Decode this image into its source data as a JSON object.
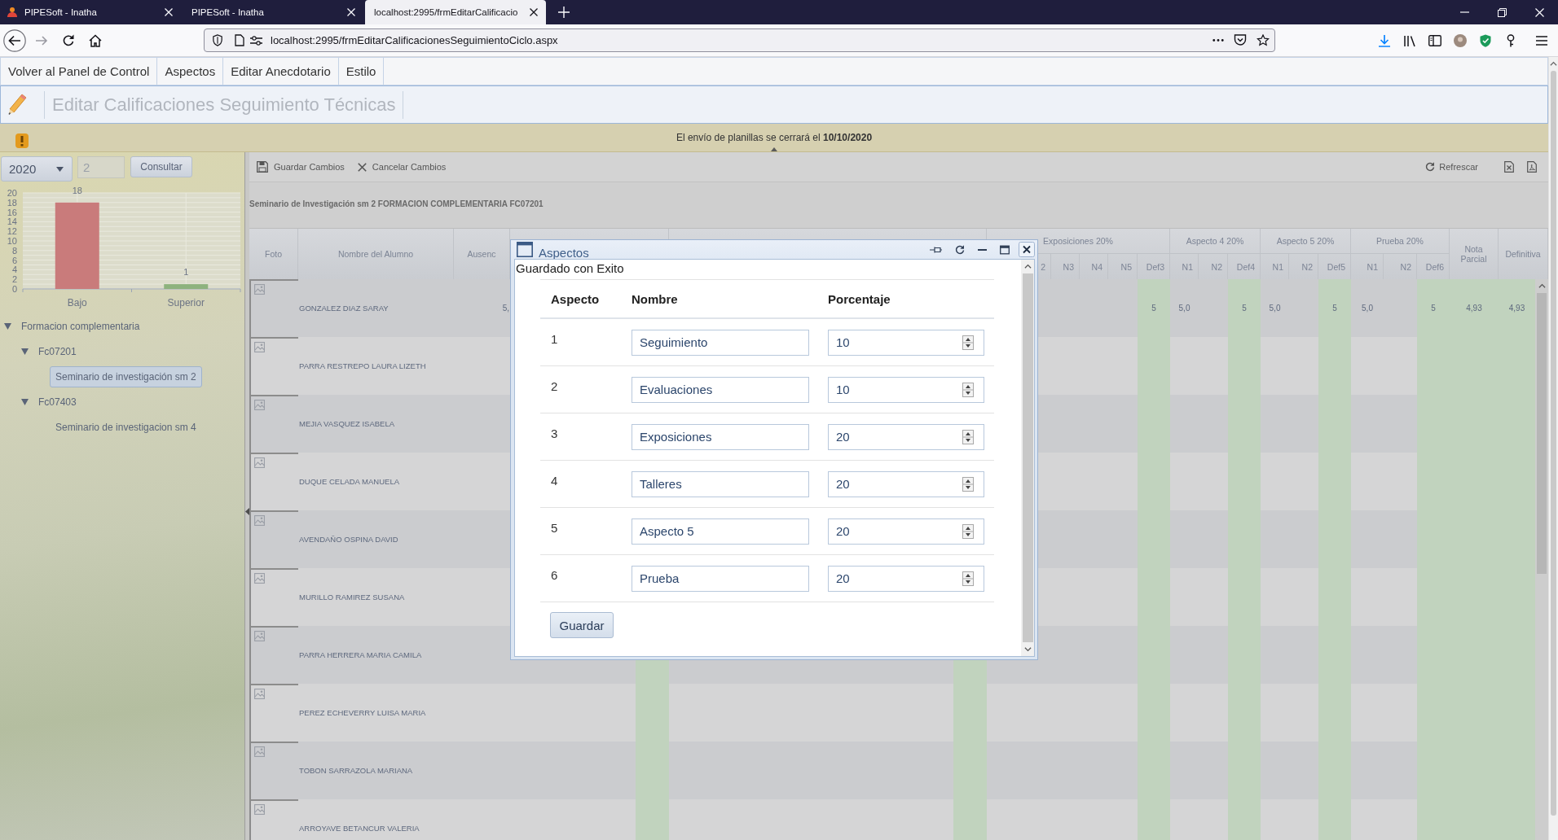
{
  "browser": {
    "tabs": [
      {
        "title": "PIPESoft - Inatha",
        "selected": false,
        "favicon": true
      },
      {
        "title": "PIPESoft - Inatha",
        "selected": false,
        "favicon": false
      },
      {
        "title": "localhost:2995/frmEditarCalificacio",
        "selected": true,
        "favicon": false
      }
    ],
    "url": "localhost:2995/frmEditarCalificacionesSeguimientoCiclo.aspx"
  },
  "menu": [
    {
      "label": "Volver al Panel de Control"
    },
    {
      "label": "Aspectos"
    },
    {
      "label": "Editar Anecdotario"
    },
    {
      "label": "Estilo"
    }
  ],
  "page_title": "Editar Calificaciones Seguimiento Técnicas",
  "notice": "El envío de planillas se cerrará el **10/10/2020**",
  "side_panel": {
    "filters": {
      "year": "2020",
      "period": "2",
      "button": "Consultar"
    },
    "chart_data": {
      "type": "bar",
      "categories": [
        "Bajo",
        "Superior"
      ],
      "series": [
        {
          "color": "#c97b7b",
          "values": [
            18,
            null
          ]
        },
        {
          "color": "#8db27e",
          "values": [
            null,
            1
          ]
        }
      ],
      "stacked": true,
      "ylim": [
        0,
        20
      ],
      "yticks": [
        0,
        2,
        4,
        6,
        8,
        10,
        12,
        14,
        16,
        18,
        20
      ],
      "grid": true,
      "data_labels": true
    },
    "tree": [
      {
        "label": "Formacion complementaria",
        "expanded": true,
        "selected": false,
        "children": [
          {
            "label": "Fc07201",
            "expanded": true,
            "selected": false,
            "children": [
              {
                "label": "Seminario de investigación sm 2",
                "selected": true
              }
            ]
          },
          {
            "label": "Fc07403",
            "expanded": true,
            "selected": false,
            "children": [
              {
                "label": "Seminario de investigacion sm 4",
                "selected": false
              }
            ]
          }
        ]
      }
    ]
  },
  "toolbar": {
    "left": [
      {
        "kind": "save",
        "label": "Guardar Cambios"
      },
      {
        "kind": "cancel",
        "label": "Cancelar Cambios"
      }
    ],
    "right": [
      {
        "kind": "refresh",
        "label": "Refrescar"
      },
      {
        "kind": "spreadsheet"
      },
      {
        "kind": "pdf"
      }
    ]
  },
  "grid": {
    "caption": "Seminario de Investigación sm 2 FORMACION COMPLEMENTARIA FC07201",
    "columns": [
      {
        "kind": "photo",
        "label": "Foto"
      },
      {
        "kind": "name",
        "label": "Nombre del Alumno"
      },
      {
        "kind": "text",
        "label": "Ausenc",
        "values": [
          "5,"
        ]
      },
      {
        "kind": "group",
        "columns": [
          {
            "kind": "grade"
          },
          {
            "kind": "grade"
          },
          {
            "kind": "grade"
          },
          {
            "kind": "grade"
          },
          {
            "kind": "final"
          }
        ]
      },
      {
        "kind": "group",
        "columns": [
          {
            "kind": "grade"
          },
          {
            "kind": "grade"
          },
          {
            "kind": "grade"
          },
          {
            "kind": "grade"
          },
          {
            "kind": "grade"
          },
          {
            "kind": "grade"
          },
          {
            "kind": "grade"
          },
          {
            "kind": "grade"
          },
          {
            "kind": "grade"
          },
          {
            "kind": "final"
          }
        ]
      },
      {
        "kind": "group",
        "label": "Exposiciones 20%",
        "columns": [
          {
            "kind": "grade"
          },
          {
            "kind": "grade",
            "label": "2"
          },
          {
            "kind": "grade",
            "label": "N3"
          },
          {
            "kind": "grade",
            "label": "N4"
          },
          {
            "kind": "grade",
            "label": "N5"
          },
          {
            "kind": "final",
            "label": "Def3",
            "values": [
              "5"
            ]
          }
        ]
      },
      {
        "kind": "group",
        "label": "Aspecto 4 20%",
        "columns": [
          {
            "kind": "grade",
            "label": "N1",
            "values": [
              "5,0"
            ]
          },
          {
            "kind": "grade",
            "label": "N2"
          },
          {
            "kind": "final",
            "label": "Def4",
            "values": [
              "5"
            ]
          }
        ]
      },
      {
        "kind": "group",
        "label": "Aspecto 5 20%",
        "columns": [
          {
            "kind": "grade",
            "label": "N1",
            "values": [
              "5,0"
            ]
          },
          {
            "kind": "grade",
            "label": "N2"
          },
          {
            "kind": "final",
            "label": "Def5",
            "values": [
              "5"
            ]
          }
        ]
      },
      {
        "kind": "group",
        "label": "Prueba 20%",
        "columns": [
          {
            "kind": "grade",
            "label": "N1",
            "values": [
              "5,0"
            ]
          },
          {
            "kind": "grade",
            "label": "N2"
          },
          {
            "kind": "final",
            "label": "Def6",
            "values": [
              "5"
            ]
          }
        ]
      },
      {
        "kind": "final",
        "label": "Nota Parcial",
        "values": [
          "4,93"
        ]
      },
      {
        "kind": "final",
        "label": "Definitiva",
        "values": [
          "4,93"
        ]
      }
    ],
    "rows": [
      {
        "name": "GONZALEZ DIAZ SARAY"
      },
      {
        "name": "PARRA RESTREPO LAURA LIZETH"
      },
      {
        "name": "MEJIA VASQUEZ ISABELA"
      },
      {
        "name": "DUQUE CELADA MANUELA"
      },
      {
        "name": "AVENDAÑO OSPINA DAVID"
      },
      {
        "name": "MURILLO RAMIREZ SUSANA"
      },
      {
        "name": "PARRA HERRERA MARIA CAMILA"
      },
      {
        "name": "PEREZ ECHEVERRY LUISA MARIA"
      },
      {
        "name": "TOBON SARRAZOLA MARIANA"
      },
      {
        "name": "ARROYAVE BETANCUR VALERIA"
      }
    ]
  },
  "dialog": {
    "title": "Aspectos",
    "message": "Guardado con Exito",
    "columns": [
      "Aspecto",
      "Nombre",
      "Porcentaje"
    ],
    "rows": [
      {
        "number": "1",
        "name": "Seguimiento",
        "percent": "10"
      },
      {
        "number": "2",
        "name": "Evaluaciones",
        "percent": "10"
      },
      {
        "number": "3",
        "name": "Exposiciones",
        "percent": "20"
      },
      {
        "number": "4",
        "name": "Talleres",
        "percent": "20"
      },
      {
        "number": "5",
        "name": "Aspecto 5",
        "percent": "20"
      },
      {
        "number": "6",
        "name": "Prueba",
        "percent": "20"
      }
    ],
    "button": "Guardar"
  }
}
